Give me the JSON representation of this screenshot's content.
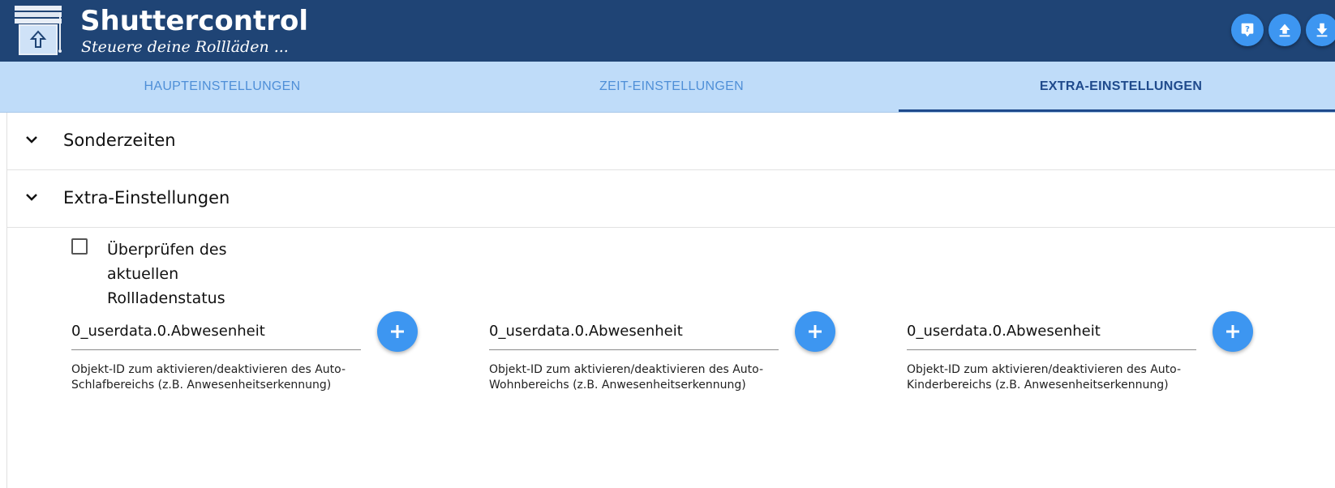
{
  "header": {
    "title": "Shuttercontrol",
    "subtitle": "Steuere deine Rollläden ...",
    "logo_icon": "shutter-logo-icon",
    "buttons": [
      {
        "name": "help-button",
        "icon": "help-icon"
      },
      {
        "name": "upload-button",
        "icon": "upload-icon"
      },
      {
        "name": "download-button",
        "icon": "download-icon"
      }
    ],
    "colors": {
      "background": "#1f4475",
      "button": "#3d96f1"
    }
  },
  "tabs": [
    {
      "label": "HAUPTEINSTELLUNGEN",
      "active": false
    },
    {
      "label": "ZEIT-EINSTELLUNGEN",
      "active": false
    },
    {
      "label": "EXTRA-EINSTELLUNGEN",
      "active": true
    }
  ],
  "sections": [
    {
      "title": "Sonderzeiten",
      "expanded": false
    },
    {
      "title": "Extra-Einstellungen",
      "expanded": true
    }
  ],
  "extra": {
    "checkbox": {
      "label": "Überprüfen des aktuellen Rollladenstatus",
      "checked": false
    },
    "fields": [
      {
        "value": "0_userdata.0.Abwesenheit",
        "help": "Objekt-ID zum aktivieren/deaktivieren des Auto-Schlafbereichs (z.B. Anwesenheitserkennung)"
      },
      {
        "value": "0_userdata.0.Abwesenheit",
        "help": "Objekt-ID zum aktivieren/deaktivieren des Auto-Wohnbereichs (z.B. Anwesenheitserkennung)"
      },
      {
        "value": "0_userdata.0.Abwesenheit",
        "help": "Objekt-ID zum aktivieren/deaktivieren des Auto-Kinderbereichs (z.B. Anwesenheitserkennung)"
      }
    ]
  }
}
